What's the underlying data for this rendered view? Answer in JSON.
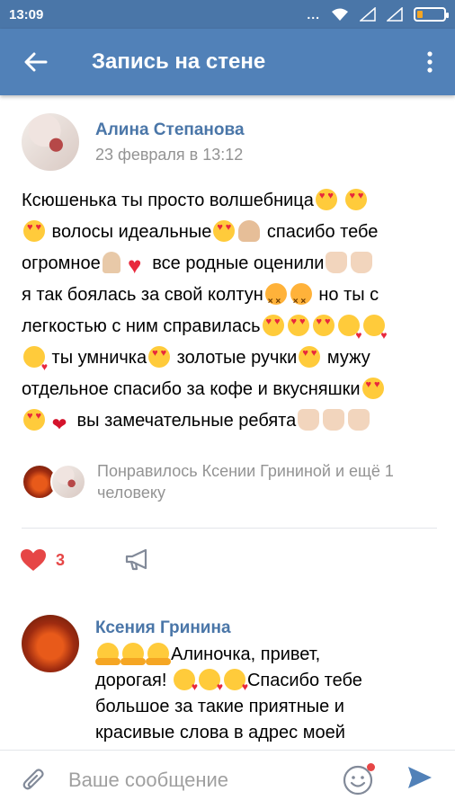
{
  "status_bar": {
    "time": "13:09",
    "dots": "..."
  },
  "app_bar": {
    "title": "Запись на стене",
    "back_icon": "arrow-left-icon",
    "menu_icon": "more-vertical-icon"
  },
  "post": {
    "author": "Алина Степанова",
    "date": "23 февраля в 13:12",
    "lines": [
      [
        "Ксюшенька ты просто волшебница",
        "[heart-eyes]",
        " ",
        "[heart-eyes]"
      ],
      [
        "[heart-eyes]",
        " волосы идеальные",
        "[heart-eyes]",
        "[ok]",
        " спасибо тебе"
      ],
      [
        "огромное",
        "[pray]",
        "[red-heart]",
        " все родные оценили",
        "[thumb]",
        "[thumb]"
      ],
      [
        "я так боялась за свой колтун",
        "[worried]",
        "[worried]",
        " но ты с"
      ],
      [
        "легкостью с ним справилась",
        "[heart-eyes]",
        "[heart-eyes]",
        "[heart-eyes]",
        "[kiss]",
        "[kiss]"
      ],
      [
        "[kiss]",
        " ты умничка",
        "[heart-eyes]",
        " золотые ручки",
        "[heart-eyes]",
        " мужу"
      ],
      [
        "отдельное спасибо за кофе и вкусняшки",
        "[heart-eyes]"
      ],
      [
        "[heart-eyes]",
        "[lips]",
        " вы замечательные ребята",
        "[thumb]",
        "[thumb]",
        "[thumb]"
      ]
    ]
  },
  "likes": {
    "text": "Понравилось Ксении Грининой и ещё 1 человеку"
  },
  "actions": {
    "like_count": "3",
    "like_color": "#e64646",
    "like_icon": "heart-icon",
    "share_icon": "megaphone-icon"
  },
  "comment": {
    "author": "Ксения Гринина",
    "lines": [
      [
        "[hug]",
        "[hug]",
        "[hug]",
        "Алиночка, привет,"
      ],
      [
        "дорогая! ",
        "[kiss]",
        "[kiss]",
        "[kiss]",
        "Спасибо тебе"
      ],
      [
        "большое за такие приятные и"
      ],
      [
        "красивые слова в адрес моей"
      ]
    ]
  },
  "composer": {
    "placeholder": "Ваше сообщение",
    "attach_icon": "paperclip-icon",
    "sticker_icon": "smiley-icon",
    "send_icon": "send-icon"
  },
  "colors": {
    "status_bar": "#4a76a8",
    "app_bar": "#5181b8",
    "link": "#4a76a8",
    "muted": "#939393",
    "send": "#5181b8"
  }
}
